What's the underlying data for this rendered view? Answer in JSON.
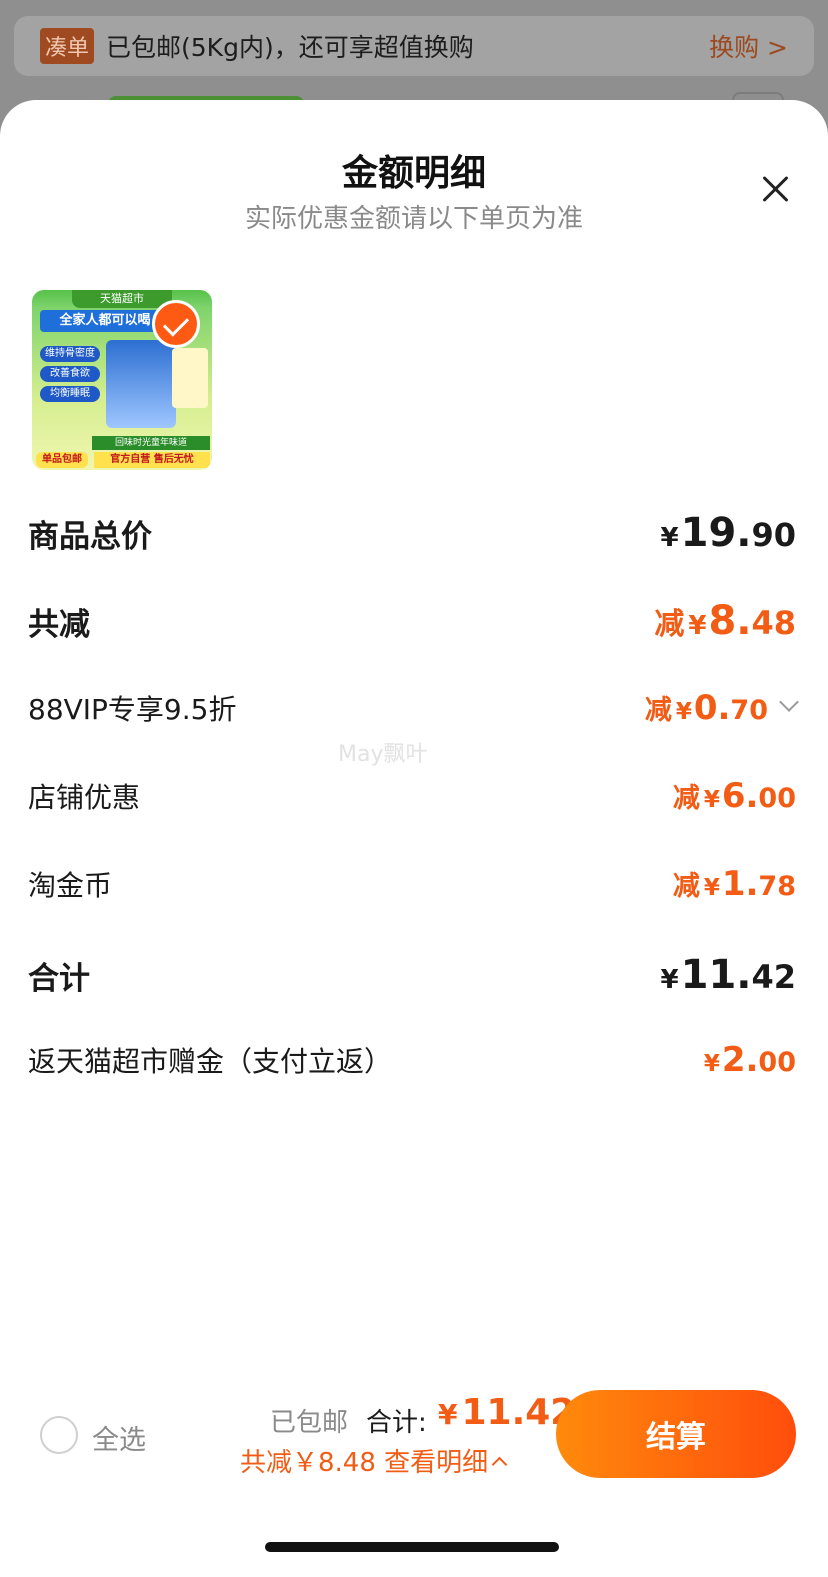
{
  "background": {
    "tag": "凑单",
    "text": "已包邮(5Kg内)，还可享超值换购",
    "link": "换购 >"
  },
  "sheet": {
    "title": "金额明细",
    "subtitle": "实际优惠金额请以下单页为准"
  },
  "product": {
    "thumb_top": "天猫超市",
    "thumb_head": "全家人都可以喝",
    "pills": [
      "维持骨密度",
      "改善食欲",
      "均衡睡眠"
    ],
    "foot": "回味时光童年味道",
    "foot2": "官方自营 售后无忧",
    "ship_badge": "单品包邮"
  },
  "rows": {
    "goods_total": {
      "label": "商品总价",
      "currency": "¥",
      "int": "19.",
      "dec": "90"
    },
    "total_off": {
      "label": "共减",
      "prefix": "减",
      "currency": "¥",
      "int": "8.",
      "dec": "48"
    },
    "vip": {
      "label": "88VIP专享9.5折",
      "prefix": "减",
      "currency": "¥",
      "int": "0.",
      "dec": "70"
    },
    "store": {
      "label": "店铺优惠",
      "prefix": "减",
      "currency": "¥",
      "int": "6.",
      "dec": "00"
    },
    "coins": {
      "label": "淘金币",
      "prefix": "减",
      "currency": "¥",
      "int": "1.",
      "dec": "78"
    },
    "sum": {
      "label": "合计",
      "currency": "¥",
      "int": "11.",
      "dec": "42"
    },
    "rebate": {
      "label": "返天猫超市赠金（支付立返）",
      "currency": "¥",
      "int": "2.",
      "dec": "00"
    }
  },
  "watermark": "May飘叶",
  "bottom": {
    "select_all": "全选",
    "shipping": "已包邮",
    "total_label": "合计:",
    "currency": "¥",
    "total_value": "11.42",
    "savings": "共减￥8.48  查看明细",
    "checkout": "结算"
  },
  "colors": {
    "accent": "#f25c14",
    "checkout_start": "#ff8a0c",
    "checkout_end": "#ff4d0c"
  }
}
